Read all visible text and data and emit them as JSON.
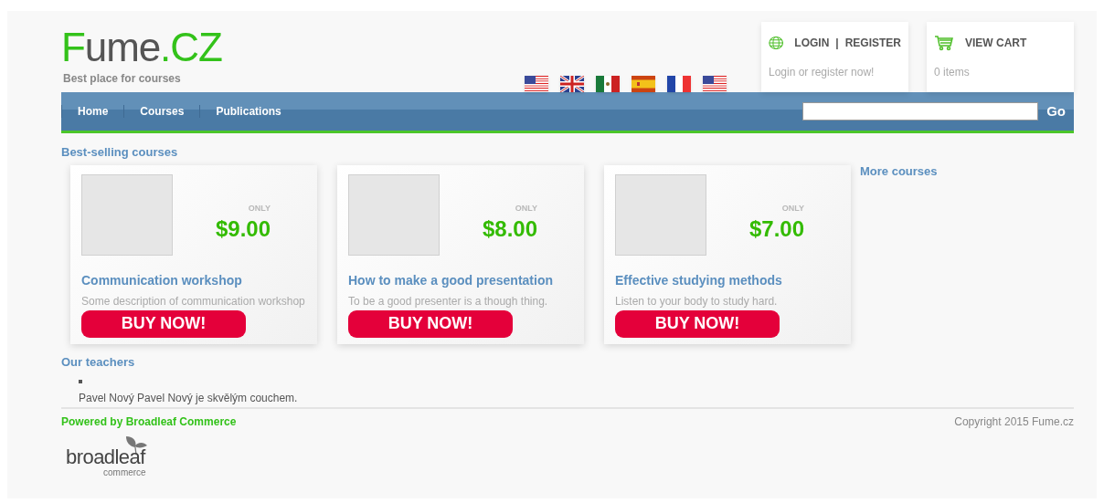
{
  "logo": {
    "parts": [
      {
        "text": "F",
        "color": "#33c21a"
      },
      {
        "text": "ume",
        "color": "#555555"
      },
      {
        "text": ".CZ",
        "color": "#33c21a"
      }
    ],
    "tagline": "Best place for courses"
  },
  "flags": [
    {
      "kind": "us"
    },
    {
      "kind": "uk"
    },
    {
      "kind": "mx"
    },
    {
      "kind": "es"
    },
    {
      "kind": "fr"
    },
    {
      "kind": "us"
    }
  ],
  "account": {
    "login": "LOGIN",
    "separator": "|",
    "register": "REGISTER",
    "hint": "Login or register now!"
  },
  "cart": {
    "label": "VIEW CART",
    "count": "0 items"
  },
  "nav": [
    {
      "label": "Home"
    },
    {
      "label": "Courses"
    },
    {
      "label": "Publications"
    }
  ],
  "search": {
    "button": "Go"
  },
  "best_selling": {
    "title": "Best-selling courses",
    "more": "More courses",
    "courses": [
      {
        "only": "ONLY",
        "price": "$9.00",
        "name": "Communication workshop",
        "description": "Some description of communication workshop",
        "button": "BUY NOW!"
      },
      {
        "only": "ONLY",
        "price": "$8.00",
        "name": "How to make a good presentation",
        "description": "To be a good presenter is a though thing.",
        "button": "BUY NOW!"
      },
      {
        "only": "ONLY",
        "price": "$7.00",
        "name": "Effective studying methods",
        "description": "Listen to your body to study hard.",
        "button": "BUY NOW!"
      }
    ]
  },
  "teachers": {
    "title": "Our teachers",
    "items": [
      {
        "text": "Pavel Nový Pavel Nový je skvělým couchem."
      }
    ]
  },
  "footer": {
    "powered": "Powered by Broadleaf Commerce",
    "copyright": "Copyright 2015 Fume.cz",
    "brand": "broadleaf",
    "brand_sub": "commerce"
  }
}
